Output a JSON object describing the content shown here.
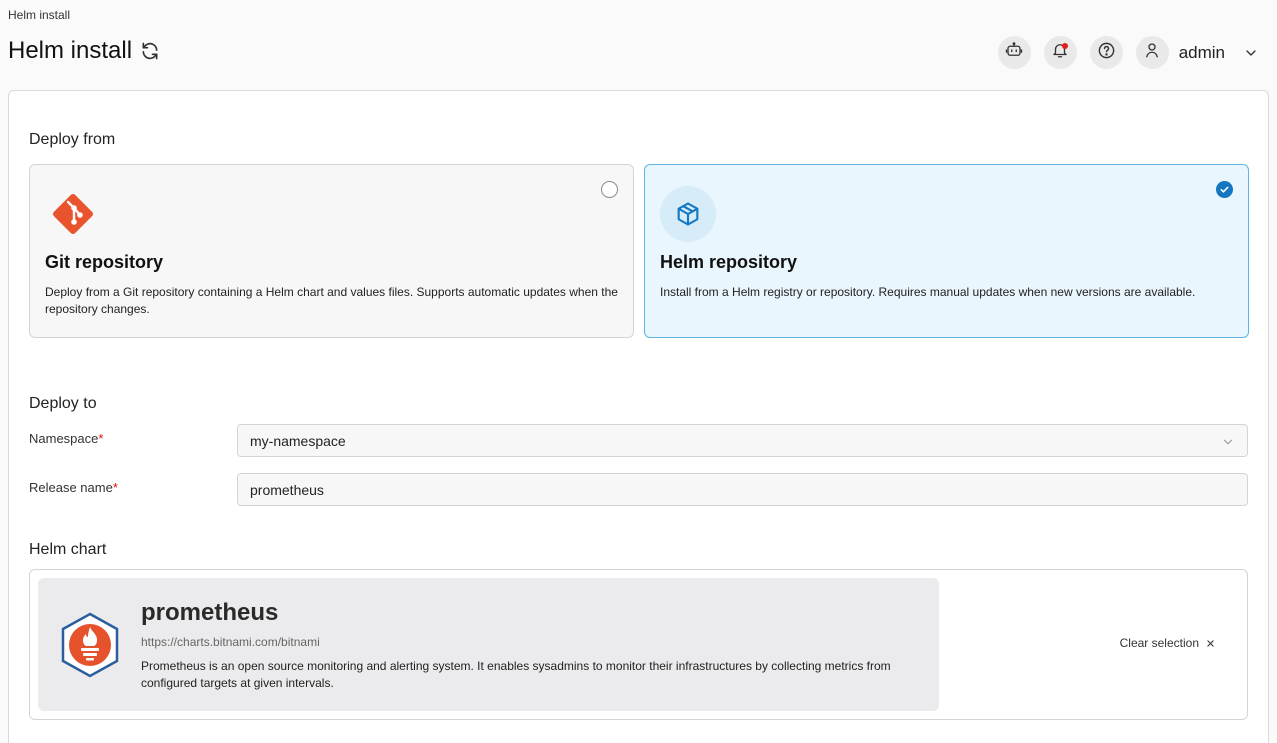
{
  "breadcrumb": "Helm install",
  "page": {
    "title": "Helm install"
  },
  "header": {
    "user_name": "admin"
  },
  "deploy_from": {
    "title": "Deploy from",
    "options": [
      {
        "title": "Git repository",
        "description": "Deploy from a Git repository containing a Helm chart and values files. Supports automatic updates when the repository changes.",
        "selected": false
      },
      {
        "title": "Helm repository",
        "description": "Install from a Helm registry or repository. Requires manual updates when new versions are available.",
        "selected": true
      }
    ]
  },
  "deploy_to": {
    "title": "Deploy to",
    "namespace": {
      "label": "Namespace",
      "required_mark": "*",
      "value": "my-namespace"
    },
    "release_name": {
      "label": "Release name",
      "required_mark": "*",
      "value": "prometheus"
    }
  },
  "helm_chart": {
    "title": "Helm chart",
    "name": "prometheus",
    "url": "https://charts.bitnami.com/bitnami",
    "description": "Prometheus is an open source monitoring and alerting system. It enables sysadmins to monitor their infrastructures by collecting metrics from configured targets at given intervals.",
    "clear_label": "Clear selection"
  },
  "colors": {
    "accent": "#1377c1",
    "selected_card_bg": "#eaf6fd",
    "git_brand": "#e9532d",
    "prometheus_brand": "#e6522c",
    "notification_dot": "#e11d1d"
  },
  "icons": [
    "refresh-icon",
    "ai-assistant-icon",
    "bell-icon",
    "help-icon",
    "user-icon",
    "chevron-down-icon",
    "git-icon",
    "package-icon",
    "check-icon",
    "prometheus-icon",
    "close-icon"
  ]
}
